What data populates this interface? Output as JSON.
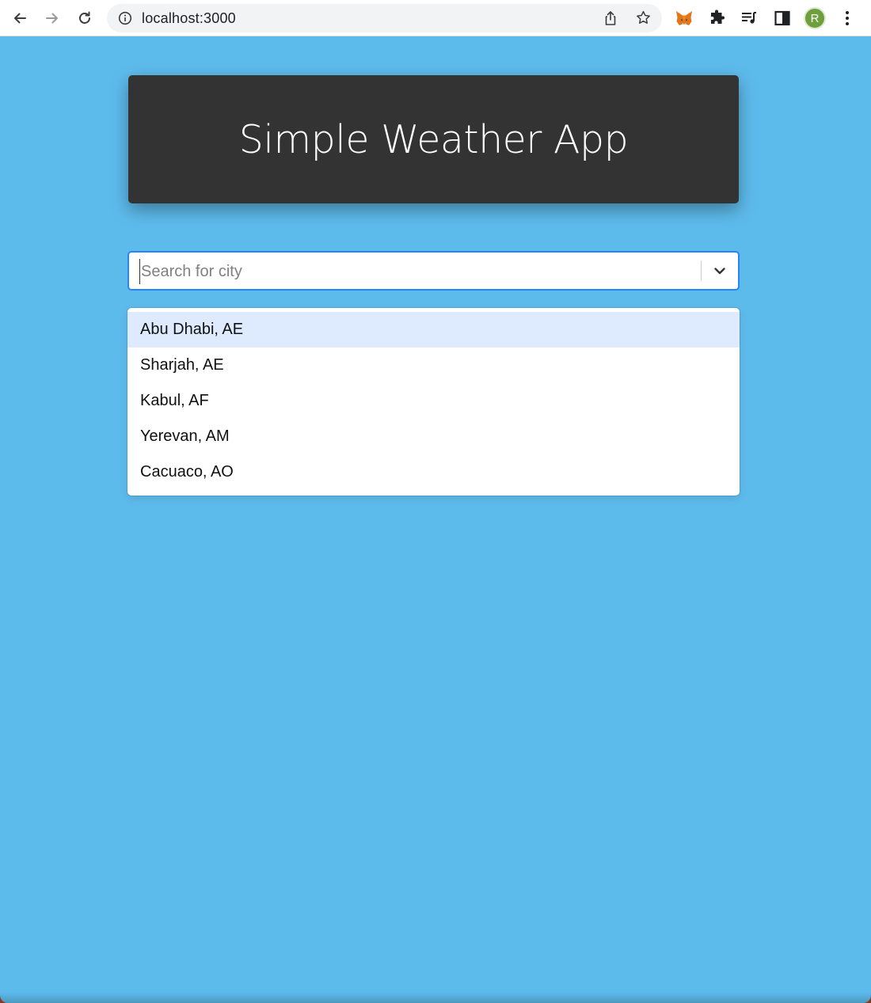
{
  "browser": {
    "url": "localhost:3000",
    "profile_initial": "R",
    "profile_color": "#6e9f3d",
    "icons": [
      "back-icon",
      "forward-icon",
      "reload-icon",
      "site-info-icon",
      "share-icon",
      "bookmark-star-icon",
      "metamask-fox-icon",
      "extensions-puzzle-icon",
      "media-queue-icon",
      "side-panel-icon",
      "more-menu-icon"
    ]
  },
  "app": {
    "title": "Simple Weather App",
    "background": "#5dbbec",
    "header_background": "#333333"
  },
  "search": {
    "placeholder": "Search for city",
    "value": "",
    "accent": "#2684ff"
  },
  "dropdown": {
    "focused_index": 0,
    "options": [
      {
        "label": "Abu Dhabi, AE"
      },
      {
        "label": "Sharjah, AE"
      },
      {
        "label": "Kabul, AF"
      },
      {
        "label": "Yerevan, AM"
      },
      {
        "label": "Cacuaco, AO"
      }
    ]
  }
}
